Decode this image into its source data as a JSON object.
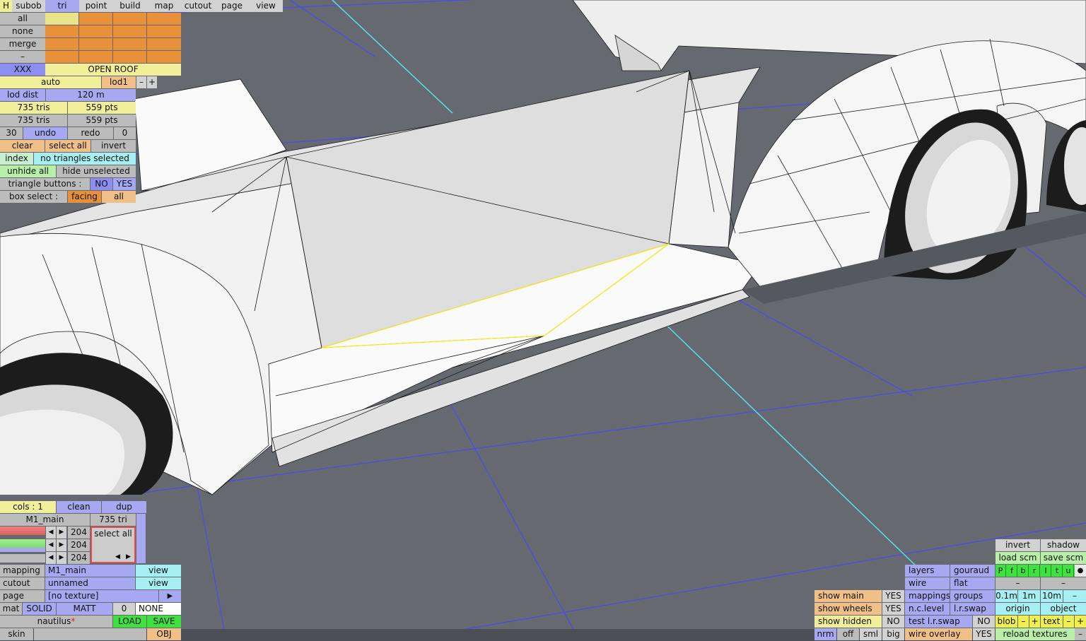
{
  "top_menu": {
    "h": "H",
    "items": [
      "subob",
      "tri",
      "point",
      "build",
      "map",
      "cutout",
      "page",
      "view"
    ],
    "active": "tri"
  },
  "subobject_panel": {
    "rows": [
      "all",
      "none",
      "merge",
      "–"
    ],
    "xxx": "XXX",
    "open_roof": "OPEN ROOF",
    "auto": "auto",
    "lod": "lod1",
    "minus": "–",
    "plus": "+",
    "lod_dist_label": "lod dist",
    "lod_dist_value": "120 m",
    "tris_1": "735 tris",
    "pts_1": "559 pts",
    "tris_2": "735 tris",
    "pts_2": "559 pts",
    "undo_count": "30",
    "undo": "undo",
    "redo": "redo",
    "redo_count": "0",
    "clear": "clear",
    "select_all": "select all",
    "invert": "invert",
    "index": "index",
    "selection_status": "no triangles selected",
    "unhide_all": "unhide all",
    "hide_unselected": "hide unselected",
    "triangle_buttons_label": "triangle buttons :",
    "no": "NO",
    "yes": "YES",
    "box_select_label": "box select :",
    "facing": "facing",
    "all": "all"
  },
  "material_panel": {
    "cols": "cols : 1",
    "clean": "clean",
    "dup": "dup",
    "material_name": "M1_main",
    "tri_count": "735 tri",
    "color_values": [
      "204",
      "204",
      "204"
    ],
    "select_all": "select all",
    "mapping_label": "mapping",
    "mapping_value": "M1_main",
    "view": "view",
    "cutout_label": "cutout",
    "cutout_value": "unnamed",
    "page_label": "page",
    "page_value": "[no texture]",
    "page_arrow": "▶",
    "mat_label": "mat",
    "solid": "SOLID",
    "matt": "MATT",
    "mat_zero": "0",
    "none": "NONE",
    "file_name": "nautilus",
    "modified_mark": "*",
    "load": "LOAD",
    "save": "SAVE",
    "skin_label": "skin",
    "obj": "OBJ"
  },
  "view_panel": {
    "show_main": "show main",
    "show_main_val": "YES",
    "show_wheels": "show wheels",
    "show_wheels_val": "YES",
    "show_hidden": "show hidden",
    "show_hidden_val": "NO",
    "nrm": "nrm",
    "off": "off",
    "sml": "sml",
    "big": "big",
    "layers": "layers",
    "gouraud": "gouraud",
    "wire": "wire",
    "flat": "flat",
    "mappings": "mappings",
    "groups": "groups",
    "nc_level": "n.c.level",
    "lr_swap": "l.r.swap",
    "test_lr_swap": "test l.r.swap",
    "test_lr_swap_val": "NO",
    "wire_overlay": "wire overlay",
    "wire_overlay_val": "YES",
    "invert": "invert",
    "shadow": "shadow",
    "load_scm": "load scm",
    "save_scm": "save scm",
    "letters": [
      "P",
      "f",
      "b",
      "r",
      "l",
      "t",
      "u",
      "●"
    ],
    "dash": "–",
    "grid_sizes": [
      "0.1m",
      "1m",
      "10m"
    ],
    "origin": "origin",
    "object": "object",
    "blob": "blob",
    "text": "text",
    "plus": "+",
    "reload_textures": "reload textures"
  }
}
